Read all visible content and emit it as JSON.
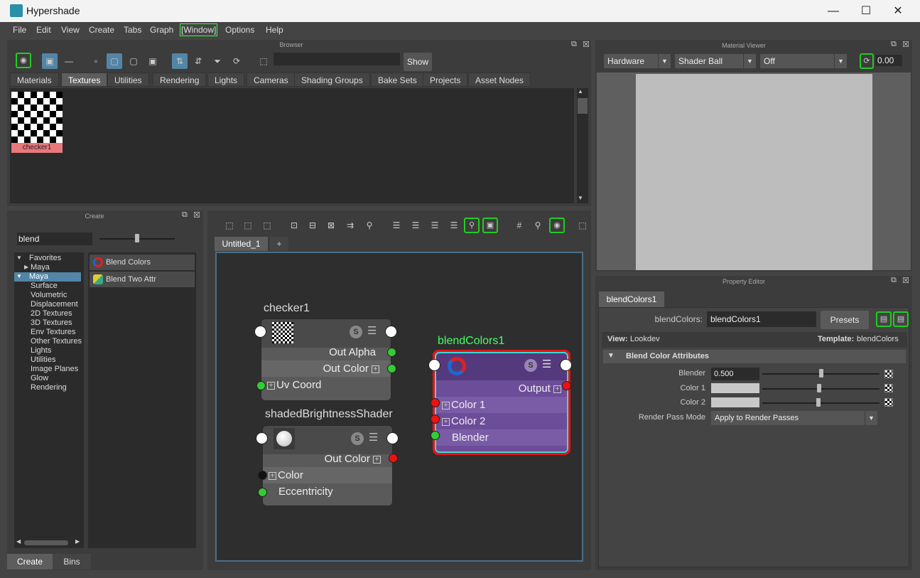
{
  "window": {
    "title": "Hypershade",
    "minimize": "—",
    "maximize": "☐",
    "close": "✕"
  },
  "menubar": {
    "items": [
      "File",
      "Edit",
      "View",
      "Create",
      "Tabs",
      "Graph",
      "[Window]",
      "Options",
      "Help"
    ]
  },
  "browser": {
    "title": "Browser",
    "show_label": "Show",
    "tabs": [
      "Materials",
      "Textures",
      "Utilities",
      "Rendering",
      "Lights",
      "Cameras",
      "Shading Groups",
      "Bake Sets",
      "Projects",
      "Asset Nodes"
    ],
    "active_tab": "Textures",
    "swatches": [
      {
        "label": "checker1"
      }
    ]
  },
  "create_panel": {
    "title": "Create",
    "search_value": "blend",
    "tree": [
      "Favorites",
      "Maya",
      "Maya",
      "Surface",
      "Volumetric",
      "Displacement",
      "2D Textures",
      "3D Textures",
      "Env Textures",
      "Other Textures",
      "Lights",
      "Utilities",
      "Image Planes",
      "Glow",
      "Rendering"
    ],
    "results": [
      "Blend Colors",
      "Blend Two Attr"
    ],
    "bottom_tabs": [
      "Create",
      "Bins"
    ]
  },
  "graph": {
    "tabs": [
      "Untitled_1",
      "+"
    ],
    "nodes": {
      "checker": {
        "name": "checker1",
        "rows": [
          "Out Alpha",
          "Out Color",
          "Uv Coord"
        ]
      },
      "shaded": {
        "name": "shadedBrightnessShader",
        "rows": [
          "Out Color",
          "Color",
          "Eccentricity"
        ]
      },
      "blend": {
        "name": "blendColors1",
        "rows": [
          "Output",
          "Color 1",
          "Color 2",
          "Blender"
        ]
      }
    },
    "s_badge": "S"
  },
  "material_viewer": {
    "title": "Material Viewer",
    "renderer": "Hardware",
    "geometry": "Shader Ball",
    "env": "Off",
    "exposure": "0.00"
  },
  "property_editor": {
    "title": "Property Editor",
    "tab": "blendColors1",
    "type_label": "blendColors:",
    "node_name": "blendColors1",
    "presets": "Presets",
    "view_label": "View:",
    "view_value": "Lookdev",
    "template_label": "Template:",
    "template_value": "blendColors",
    "section": "Blend Color Attributes",
    "blender_label": "Blender",
    "blender_value": "0.500",
    "color1_label": "Color 1",
    "color2_label": "Color 2",
    "rpm_label": "Render Pass Mode",
    "rpm_value": "Apply to Render Passes"
  },
  "colors": {
    "accent": "#5285a6",
    "green_port": "#33cc33",
    "red_port": "#ee1111",
    "blend_node": "#4f3777"
  }
}
